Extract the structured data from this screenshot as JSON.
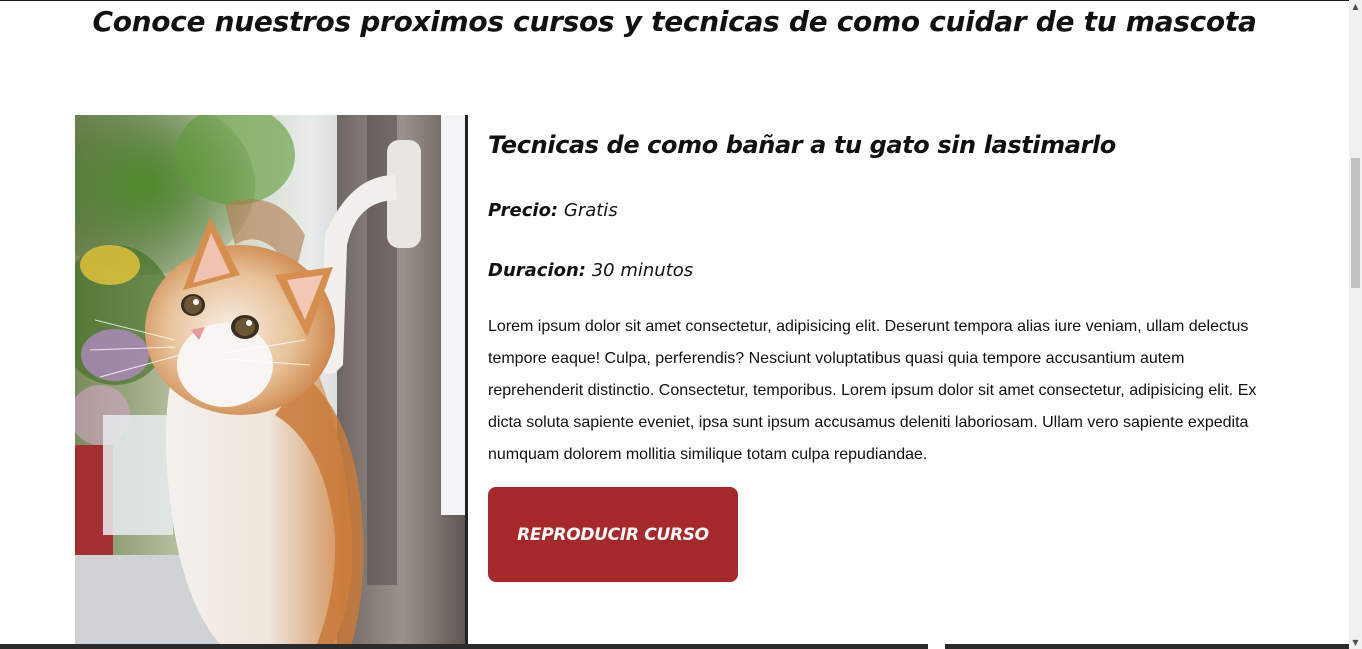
{
  "page": {
    "title": "Conoce nuestros proximos cursos y tecnicas de como cuidar de tu mascota"
  },
  "course": {
    "image_subject": "orange-and-white kitten beside a window handle",
    "title": "Tecnicas de como bañar a tu gato sin lastimarlo",
    "price_label": "Precio:",
    "price_value": "Gratis",
    "duration_label": "Duracion:",
    "duration_value": "30 minutos",
    "description": "Lorem ipsum dolor sit amet consectetur, adipisicing elit. Deserunt tempora alias iure veniam, ullam delectus tempore eaque! Culpa, perferendis? Nesciunt voluptatibus quasi quia tempore accusantium autem reprehenderit distinctio. Consectetur, temporibus. Lorem ipsum dolor sit amet consectetur, adipisicing elit. Ex dicta soluta sapiente eveniet, ipsa sunt ipsum accusamus deleniti laboriosam. Ullam vero sapiente expedita numquam dolorem mollitia similique totam culpa repudiandae.",
    "button_label": "REPRODUCIR CURSO"
  },
  "colors": {
    "button": "#a5292a",
    "text": "#111111",
    "background": "#ffffff"
  },
  "icons": {
    "scroll_up": "triangle-up",
    "scroll_down": "triangle-down"
  }
}
